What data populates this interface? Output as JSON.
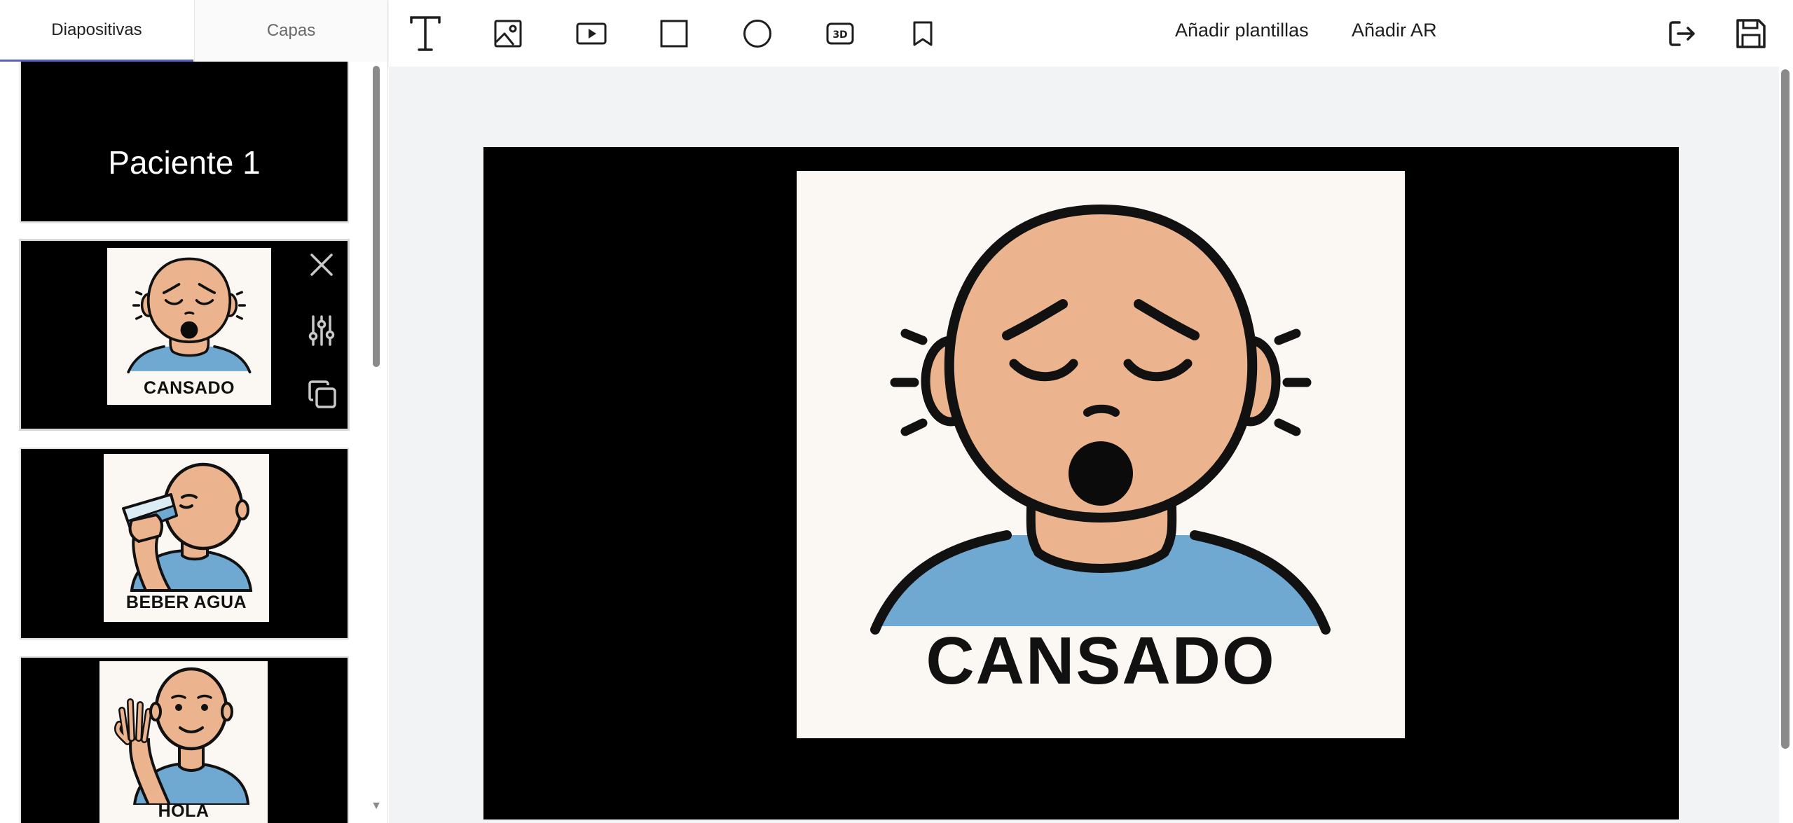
{
  "tabs": [
    {
      "label": "Diapositivas",
      "active": true
    },
    {
      "label": "Capas",
      "active": false
    }
  ],
  "slides": [
    {
      "title": "Paciente 1"
    },
    {
      "card_label": "CANSADO"
    },
    {
      "card_label": "BEBER AGUA"
    },
    {
      "card_label": "HOLA"
    }
  ],
  "toolbar": {
    "tools": [
      {
        "name": "text-icon"
      },
      {
        "name": "image-icon"
      },
      {
        "name": "video-icon"
      },
      {
        "name": "square-icon"
      },
      {
        "name": "circle-icon"
      },
      {
        "name": "3d-icon",
        "glyph": "3D"
      },
      {
        "name": "bookmark-icon"
      }
    ],
    "add_templates": "Añadir plantillas",
    "add_ar": "Añadir AR",
    "exit_icon": "exit-icon",
    "save_icon": "save-icon"
  },
  "main_slide": {
    "card_label": "CANSADO"
  },
  "colors": {
    "accent": "#5b5fc7",
    "slide_bg": "#000000",
    "card_bg": "#fbf8f4",
    "skin": "#ebb48e",
    "shirt": "#6fa8d0",
    "canvas_bg": "#f2f3f5"
  }
}
